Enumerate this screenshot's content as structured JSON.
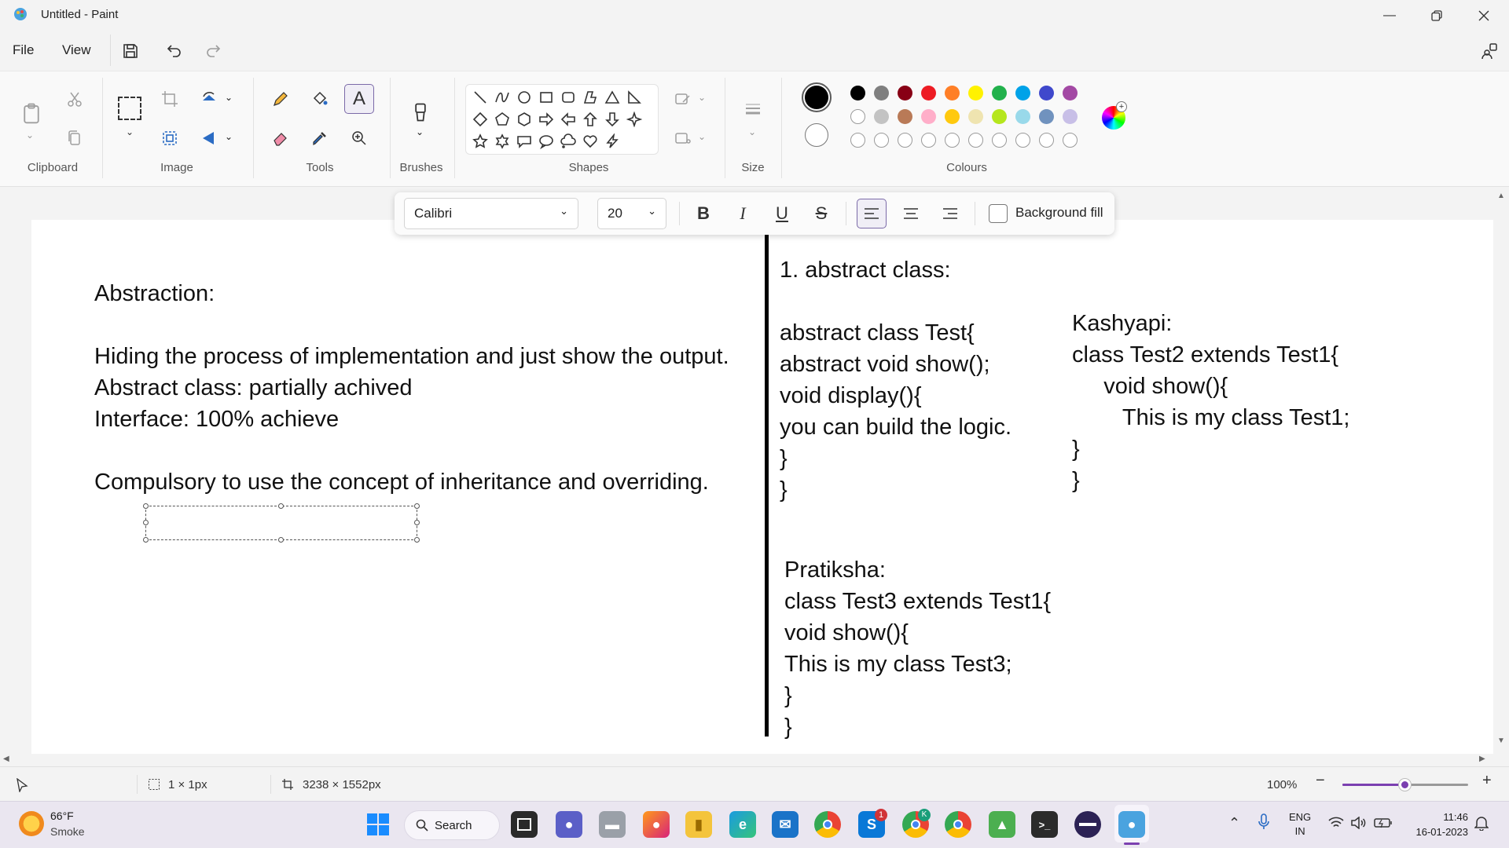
{
  "window": {
    "title": "Untitled - Paint",
    "minimize_icon": "minimize-icon",
    "maximize_icon": "restore-icon",
    "close_icon": "close-icon"
  },
  "menu": {
    "file": "File",
    "view": "View"
  },
  "ribbon": {
    "groups": {
      "clipboard": "Clipboard",
      "image": "Image",
      "tools": "Tools",
      "brushes": "Brushes",
      "shapes": "Shapes",
      "size": "Size",
      "colours": "Colours"
    },
    "colours_row1": [
      "#000000",
      "#7f7f7f",
      "#880015",
      "#ed1c24",
      "#ff7f27",
      "#fff200",
      "#22b14c",
      "#00a2e8",
      "#3f48cc",
      "#a349a4"
    ],
    "colours_row2": [
      "#ffffff",
      "#c3c3c3",
      "#b97a57",
      "#ffaec9",
      "#ffc90e",
      "#efe4b0",
      "#b5e61d",
      "#99d9ea",
      "#7092be",
      "#c8bfe7"
    ],
    "primary_colour": "#000000",
    "secondary_colour": "#ffffff"
  },
  "textbar": {
    "font": "Calibri",
    "size": "20",
    "bold": "B",
    "italic": "I",
    "underline": "U",
    "strike": "S",
    "background_fill": "Background fill"
  },
  "canvas": {
    "left_block": [
      "Abstraction:",
      "",
      "Hiding the process of implementation and just show the output.",
      "Abstract class: partially achived",
      "Interface: 100% achieve",
      "",
      "Compulsory to use the concept of inheritance and overriding."
    ],
    "mid_top": [
      "1. abstract class:",
      "",
      "abstract class Test{",
      "abstract void show();",
      "void display(){",
      "you can build the logic.",
      "}",
      "}"
    ],
    "right_block": [
      "Kashyapi:",
      "class Test2 extends Test1{",
      "     void show(){",
      "        This is my class Test1;",
      "}",
      "}"
    ],
    "mid_bottom": [
      "Pratiksha:",
      "class Test3 extends Test1{",
      "void show(){",
      "This is my class Test3;",
      "}",
      "}"
    ]
  },
  "status": {
    "selection_size": "1 × 1px",
    "canvas_size": "3238 × 1552px",
    "zoom": "100%",
    "zoom_level": 0.5
  },
  "taskbar": {
    "weather_temp": "66°F",
    "weather_desc": "Smoke",
    "search": "Search",
    "lang1": "ENG",
    "lang2": "IN",
    "time": "11:46",
    "date": "16-01-2023",
    "skype_badge": "1",
    "chrome_badge": "K"
  }
}
